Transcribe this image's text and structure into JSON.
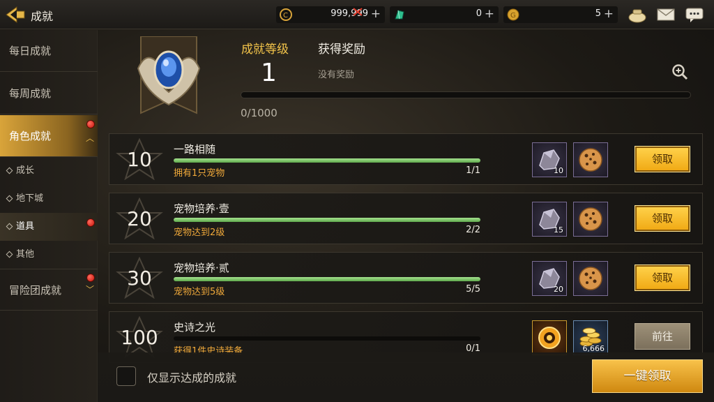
{
  "topbar": {
    "title": "成就",
    "currencies": [
      {
        "name": "gold-coin",
        "value": "999,999"
      },
      {
        "name": "green-crystal",
        "value": "0"
      },
      {
        "name": "gold-token",
        "value": "5"
      }
    ],
    "plus": "+"
  },
  "sidebar": {
    "daily": "每日成就",
    "weekly": "每周成就",
    "character": "角色成就",
    "subs": [
      "成长",
      "地下城",
      "道具",
      "其他"
    ],
    "adventure": "冒险团成就"
  },
  "header": {
    "level_label": "成就等级",
    "level": "1",
    "reward_label": "获得奖励",
    "no_reward": "没有奖励",
    "progress": "0/1000",
    "progress_value": 0
  },
  "rows": [
    {
      "level": "10",
      "title": "一路相随",
      "desc": "拥有1只宠物",
      "count": "1/1",
      "fill": 1.0,
      "reward_qty": "10",
      "button": "领取"
    },
    {
      "level": "20",
      "title": "宠物培养·壹",
      "desc": "宠物达到2级",
      "count": "2/2",
      "fill": 1.0,
      "reward_qty": "15",
      "button": "领取"
    },
    {
      "level": "30",
      "title": "宠物培养·贰",
      "desc": "宠物达到5级",
      "count": "5/5",
      "fill": 1.0,
      "reward_qty": "20",
      "button": "领取"
    },
    {
      "level": "100",
      "title": "史诗之光",
      "desc": "获得1件史诗装备",
      "count": "0/1",
      "fill": 0.0,
      "reward_qty": "6,666",
      "button": "前往"
    }
  ],
  "bottom": {
    "filter_label": "仅显示达成的成就",
    "claim_all": "一键领取"
  },
  "colors": {
    "accent": "#f3c44a",
    "progress": "#7cc565",
    "claim": "#f5b623"
  }
}
